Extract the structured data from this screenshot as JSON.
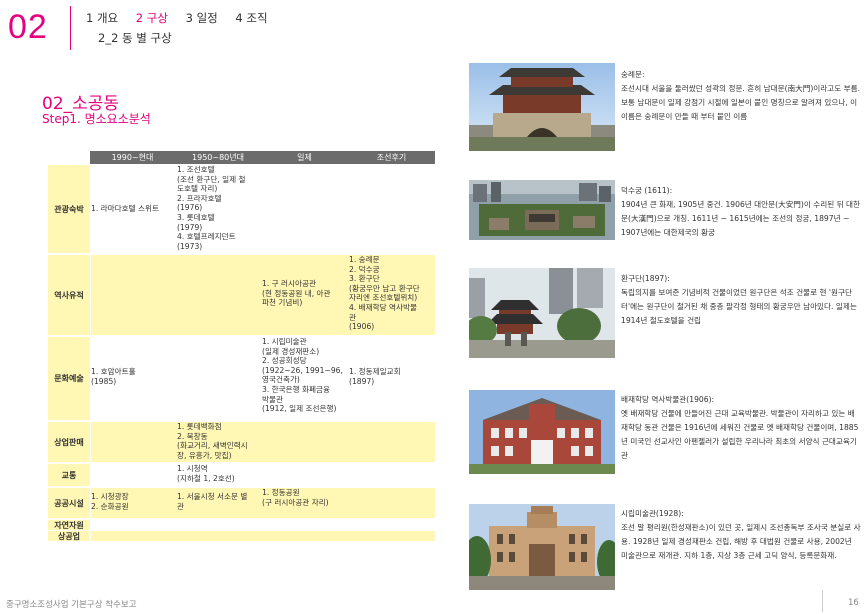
{
  "header": {
    "chapter": "02",
    "nav": [
      "1 개요",
      "2 구상",
      "3 일정",
      "4 조직"
    ],
    "active_index": 1,
    "subnav": "2_2 동 별 구상"
  },
  "title": "02_소공동",
  "step": "Step1. 명소요소분석",
  "table": {
    "columns": [
      "1990~현대",
      "1950~80년대",
      "일제",
      "조선후기"
    ],
    "rows": [
      {
        "label": "관광숙박",
        "cells": [
          "1. 라마다호텔 스위트",
          "1. 조선호텔\n(조선 환구단, 일제 철\n도호텔 자리)\n2. 프라자호텔\n(1976)\n3. 롯데호텔\n(1979)\n4. 호텔프레지던트\n(1973)",
          "",
          ""
        ]
      },
      {
        "label": "역사유적",
        "cells": [
          "",
          "",
          "1. 구 러시아공관\n(현 정동공원 내, 아관\n파천 기념비)",
          "1. 숭례문\n2. 덕수궁\n3. 환구단\n(황궁우만 남고 환구단\n자리엔 조선호텔위치)\n4. 배재학당 역사박물\n관\n(1906)"
        ]
      },
      {
        "label": "문화예술",
        "cells": [
          "1. 호암아트홀\n(1985)",
          "",
          "1. 시립미술관\n(일제 경성재판소)\n2. 성공회성당\n(1922~26, 1991~96,\n영국건축가)\n3. 한국은행 화폐금융\n박물관\n(1912, 일제 조선은행)",
          "1. 정동제일교회\n(1897)"
        ]
      },
      {
        "label": "상업판매",
        "cells": [
          "",
          "1. 롯데백화점\n2. 북창동\n(화교거리, 새벽인력시\n장, 유흥가, 맛집)",
          "",
          ""
        ]
      },
      {
        "label": "교통",
        "cells": [
          "",
          "1. 시청역\n(지하철 1, 2호선)",
          "",
          ""
        ]
      },
      {
        "label": "공공시설",
        "cells": [
          "1. 시청광장\n2. 순화공원",
          "1. 서울시청 서소문 별\n관",
          "1. 정동공원\n(구 러시아공관 자리)",
          ""
        ]
      },
      {
        "label": "자연자원",
        "cells": [
          "",
          "",
          "",
          ""
        ]
      },
      {
        "label": "상공업",
        "cells": [
          "",
          "",
          "",
          ""
        ]
      }
    ]
  },
  "landmarks": [
    {
      "name": "숭례문:",
      "text": "조선시대 서울을 둘러쌌던 성곽의 정문. 흔히 남대문(南大門)이라고도 부름. 보통 남대문이 일제 강점기 시절에 일본이 붙인 명칭으로 알려져 있으나, 이 이름은 숭례문이 만들 때 부터 붙인 이름"
    },
    {
      "name": "덕수궁 (1611):",
      "text": "1904년 큰 화재, 1905년 중건. 1906년 대안문(大安門)이 수리된 뒤 대한문(大漢門)으로 개칭. 1611년 ~ 1615년에는 조선의 정궁, 1897년 ~ 1907년에는 대한제국의 황궁"
    },
    {
      "name": "환구단(1897):",
      "text": "독립의지를 보여준 기념비적 건물이었던 원구단은 석조 건물로 현 '원구단 터'에는 원구단이 철거된 채 중층 팔각정 형태의 황궁우만 남아있다. 일제는 1914년 철도호텔을 건립"
    },
    {
      "name": "배재학당 역사박물관(1906):",
      "text": "옛 배재학당 건물에 만들어진 근대 교육박물관. 박물관이 자리하고 있는 배재학당 동관 건물은 1916년에 세워진 건물로 옛 배재학당 건물이며, 1885년 미국인 선교사인 아펜젤러가 설립한 우리나라 최초의 서양식 근대교육기관"
    },
    {
      "name": "시립미술관(1928):",
      "text": "조선 말 평리원(한성재판소)이 있던 곳, 일제시 조선총독부 조사국 분실로 사용. 1928년 일제 경성재판소 건립, 해방 후 대법원 건물로 사용, 2002년 미술관으로 재개관. 지하 1층, 지상 3층 근세 고딕 양식, 등록문화재."
    }
  ],
  "footer": {
    "report": "중구명소조성사업 기본구상 착수보고",
    "page": "16"
  },
  "colors": {
    "accent": "#e4007f",
    "table_fill": "#fff7b3",
    "header_fill": "#6b6b6b"
  }
}
